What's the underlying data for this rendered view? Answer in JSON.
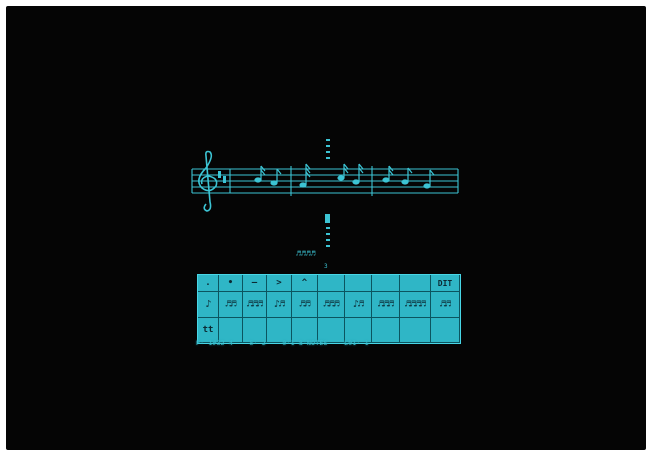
{
  "palette": {
    "row1": [
      ".",
      "•",
      "—",
      ">",
      "^",
      "",
      "",
      "",
      "",
      "DIT"
    ],
    "row2": [
      "♪",
      "♬♬",
      "♬♬♬",
      "♪♬",
      "♬♬",
      "♬♬♬",
      "♪♬",
      "♬♬♬",
      "♬♬♬♬",
      "♬♬"
    ],
    "row3": [
      "tt",
      "",
      "",
      "",
      "",
      "",
      "",
      "",
      "",
      ""
    ]
  },
  "cursor": {
    "label": "♬♬♬♬",
    "number": "3"
  },
  "status": {
    "line": "P· 1#32 4    5· 2    0·1 8·NOTES    L01· 1"
  },
  "colors": {
    "screen": "#050505",
    "phosphor": "#37c0d0",
    "palette_bg": "#2fb6c6"
  }
}
